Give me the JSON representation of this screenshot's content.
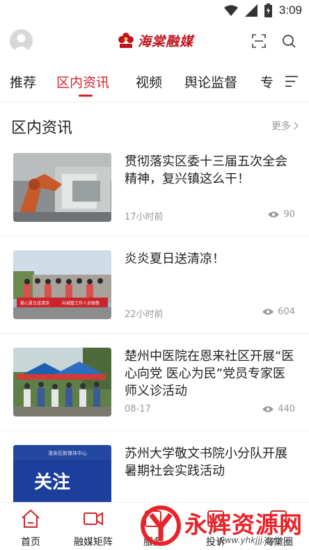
{
  "status_bar": {
    "time": "3:09"
  },
  "header": {
    "logo_text": "海棠融媒"
  },
  "tabs": [
    {
      "label": "推荐"
    },
    {
      "label": "区内资讯"
    },
    {
      "label": "视频"
    },
    {
      "label": "舆论监督"
    },
    {
      "label": "专"
    }
  ],
  "active_tab": "区内资讯",
  "section": {
    "title": "区内资讯",
    "more_label": "更多"
  },
  "articles": [
    {
      "title": "贯彻落实区委十三届五次全会精神，复兴镇这么干！",
      "time": "17小时前",
      "views": "90"
    },
    {
      "title": "炎炎夏日送清凉！",
      "time": "22小时前",
      "views": "604"
    },
    {
      "title": "楚州中医院在恩来社区开展“医心向党 医心为民”党员专家医师义诊活动",
      "time": "08-17",
      "views": "440"
    },
    {
      "title": " 苏州大学敬文书院小分队开展暑期社会实践活动",
      "time": "",
      "views": ""
    }
  ],
  "thumb_texts": {
    "banner_left": "爱心夏日送清凉",
    "banner_right": "向城管工作人员致敬",
    "follow_org": "淮安区新媒体中心",
    "follow_text": "关注"
  },
  "bottom_nav": [
    {
      "label": "首页"
    },
    {
      "label": "融媒矩阵"
    },
    {
      "label": "服务"
    },
    {
      "label": "投诉"
    },
    {
      "label": "海棠圈"
    }
  ],
  "watermark": {
    "text": "永辉资源网",
    "url": "www.yhkjjj.com"
  },
  "colors": {
    "accent": "#d1252b",
    "logo": "#c0131b",
    "muted": "#999999"
  }
}
